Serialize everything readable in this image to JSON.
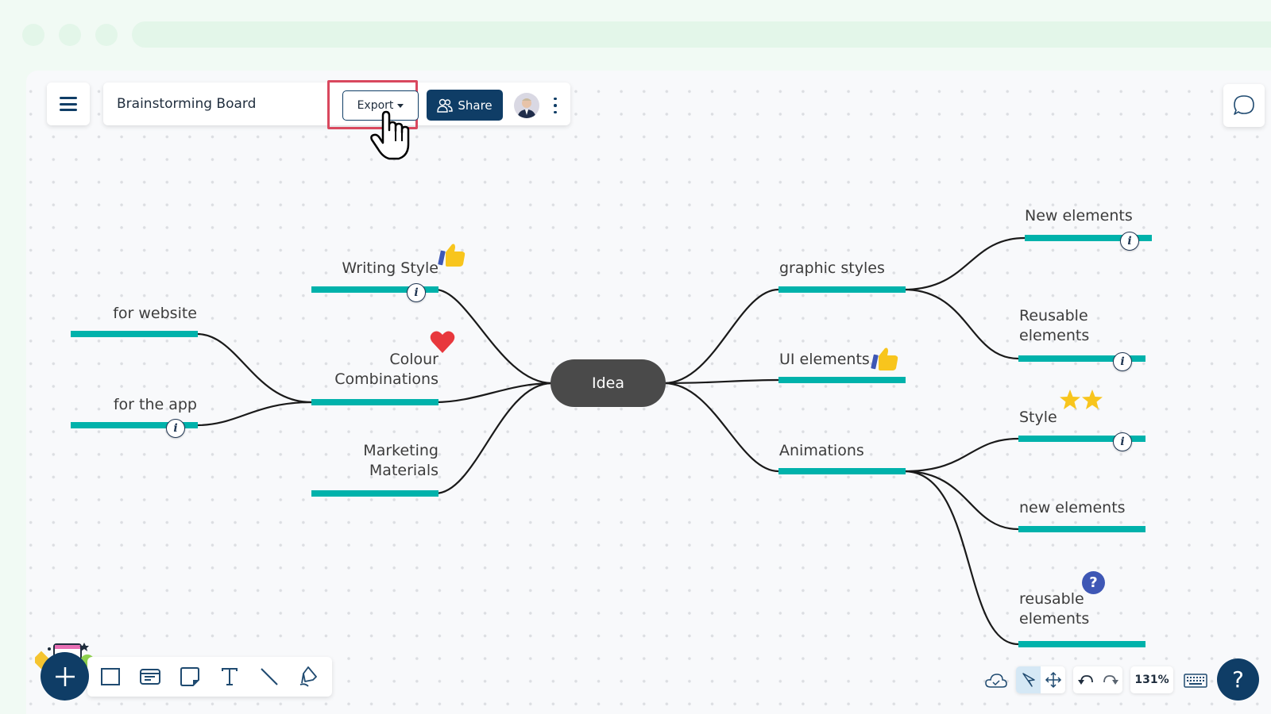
{
  "header": {
    "board_title": "Brainstorming Board",
    "export_label": "Export",
    "share_label": "Share"
  },
  "mindmap": {
    "center": "Idea",
    "left_branches": [
      {
        "label": "Writing Style",
        "reaction": "thumbs-up",
        "has_info": true
      },
      {
        "label_lines": [
          "Colour",
          "Combinations"
        ],
        "reaction": "heart",
        "has_info": false,
        "children": [
          {
            "label": "for website",
            "has_info": false
          },
          {
            "label": "for the app",
            "has_info": true
          }
        ]
      },
      {
        "label_lines": [
          "Marketing",
          "Materials"
        ],
        "has_info": false
      }
    ],
    "right_branches": [
      {
        "label": "graphic styles",
        "has_info": false,
        "children": [
          {
            "label": "New elements",
            "has_info": true
          },
          {
            "label_lines": [
              "Reusable",
              "elements"
            ],
            "has_info": true
          }
        ]
      },
      {
        "label": "UI elements",
        "reaction": "thumbs-up",
        "has_info": false
      },
      {
        "label": "Animations",
        "has_info": false,
        "children": [
          {
            "label": "Style",
            "reaction": "two-stars",
            "has_info": true
          },
          {
            "label": "new elements",
            "has_info": false
          },
          {
            "label_lines": [
              "reusable",
              "elements"
            ],
            "reaction": "question",
            "has_info": false
          }
        ]
      }
    ],
    "info_glyph": "i",
    "question_glyph": "?"
  },
  "bottom_bar": {
    "zoom_level": "131%",
    "help_glyph": "?"
  },
  "colors": {
    "brand": "#0f3d66",
    "branch_bar": "#00b2ab",
    "center_node": "#4a4a4a",
    "highlight": "#d9485e"
  }
}
